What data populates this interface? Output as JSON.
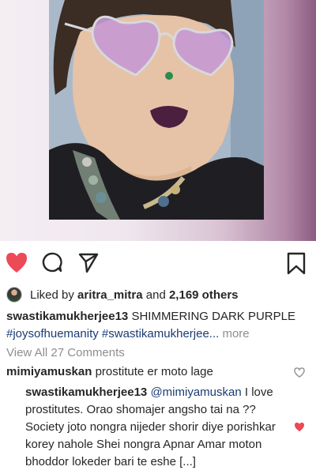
{
  "post": {
    "liked_by_prefix": "Liked by",
    "liked_by_user": "aritra_mitra",
    "liked_by_connector": "and",
    "likes_count": "2,169 others",
    "caption_author": "swastikamukherjee13",
    "caption_text": "SHIMMERING DARK PURPLE",
    "caption_hashtags": "#joysofhuemanity #swastikamukherjee...",
    "more_label": "more",
    "view_all_comments": "View All 27 Comments",
    "liked": true
  },
  "comments": [
    {
      "author": "mimiyamuskan",
      "text": "prostitute er moto lage",
      "liked": false
    },
    {
      "author": "swastikamukherjee13",
      "mention": "@mimiyamuskan",
      "text": "I love prostitutes. Orao shomajer angsho tai na ?? Society joto nongra nijeder shorir diye porishkar korey nahole Shei nongra Apnar Amar moton bhoddor lokeder bari te eshe [...]",
      "liked": true
    }
  ],
  "icons": {
    "like": "heart-icon",
    "comment": "comment-bubble-icon",
    "share": "paper-plane-icon",
    "save": "bookmark-icon"
  },
  "colors": {
    "like_red": "#ed4956",
    "hashtag_blue": "#1a3b73",
    "muted_gray": "#8e8e8e"
  }
}
